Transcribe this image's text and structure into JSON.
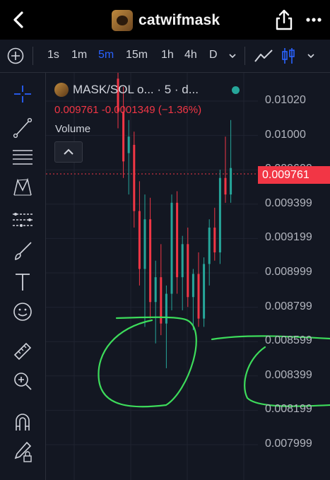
{
  "header": {
    "title": "catwifmask"
  },
  "toolbar": {
    "timeframes": [
      "1s",
      "1m",
      "5m",
      "15m",
      "1h",
      "4h",
      "D"
    ],
    "active_timeframe": "5m"
  },
  "legend": {
    "symbol": "MASK/SOL o... · 5 · d...",
    "price_line": "0.009761 -0.0001349 (−1.36%)",
    "volume_label": "Volume"
  },
  "colors": {
    "up": "#26a69a",
    "down": "#f23645",
    "accent": "#2962ff",
    "annotation": "#3ddc5b"
  },
  "chart_data": {
    "type": "candlestick",
    "y_axis_labels": [
      "0.01020",
      "0.01000",
      "0.009600",
      "0.009399",
      "0.009199",
      "0.008999",
      "0.008799",
      "0.008599",
      "0.008399",
      "0.008199",
      "0.007999"
    ],
    "last_price": "0.009761",
    "ylim": [
      0.0079,
      0.01025
    ],
    "candles": [
      {
        "o": 0.0103,
        "h": 0.0104,
        "l": 0.01,
        "c": 0.0101
      },
      {
        "o": 0.0101,
        "h": 0.01025,
        "l": 0.0097,
        "c": 0.0098
      },
      {
        "o": 0.00985,
        "h": 0.01005,
        "l": 0.0096,
        "c": 0.00995
      },
      {
        "o": 0.0099,
        "h": 0.00998,
        "l": 0.0094,
        "c": 0.0095
      },
      {
        "o": 0.0095,
        "h": 0.00968,
        "l": 0.00905,
        "c": 0.00915
      },
      {
        "o": 0.00915,
        "h": 0.0096,
        "l": 0.0088,
        "c": 0.00945
      },
      {
        "o": 0.00945,
        "h": 0.00958,
        "l": 0.00885,
        "c": 0.00895
      },
      {
        "o": 0.00895,
        "h": 0.0092,
        "l": 0.0087,
        "c": 0.0091
      },
      {
        "o": 0.0091,
        "h": 0.0093,
        "l": 0.00875,
        "c": 0.00882
      },
      {
        "o": 0.00882,
        "h": 0.00905,
        "l": 0.00855,
        "c": 0.009
      },
      {
        "o": 0.009,
        "h": 0.0096,
        "l": 0.0089,
        "c": 0.00955
      },
      {
        "o": 0.00955,
        "h": 0.00962,
        "l": 0.009,
        "c": 0.0091
      },
      {
        "o": 0.0091,
        "h": 0.00935,
        "l": 0.0089,
        "c": 0.0093
      },
      {
        "o": 0.0093,
        "h": 0.0094,
        "l": 0.00892,
        "c": 0.00898
      },
      {
        "o": 0.00898,
        "h": 0.00915,
        "l": 0.00878,
        "c": 0.00912
      },
      {
        "o": 0.00912,
        "h": 0.00925,
        "l": 0.0088,
        "c": 0.00885
      },
      {
        "o": 0.00885,
        "h": 0.00922,
        "l": 0.0088,
        "c": 0.00918
      },
      {
        "o": 0.00918,
        "h": 0.00945,
        "l": 0.00905,
        "c": 0.0094
      },
      {
        "o": 0.0094,
        "h": 0.00952,
        "l": 0.0092,
        "c": 0.00925
      },
      {
        "o": 0.00925,
        "h": 0.00975,
        "l": 0.00918,
        "c": 0.0097
      },
      {
        "o": 0.0097,
        "h": 0.00995,
        "l": 0.00955,
        "c": 0.0096
      },
      {
        "o": 0.0096,
        "h": 0.01005,
        "l": 0.00955,
        "c": 0.00976
      }
    ]
  }
}
